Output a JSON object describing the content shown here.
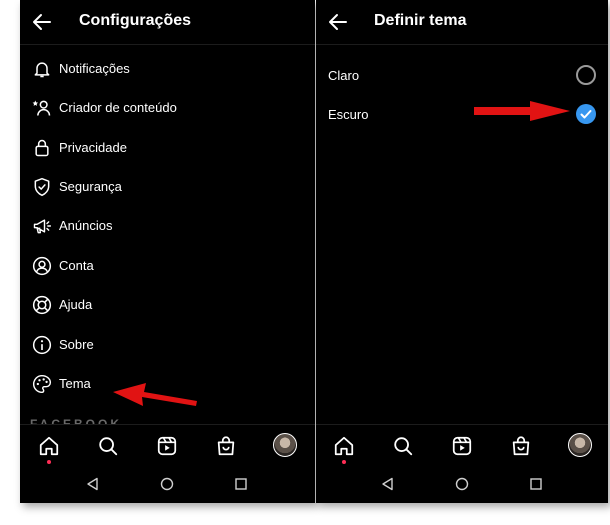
{
  "left": {
    "title": "Configurações",
    "menu": [
      {
        "label": "Notificações",
        "icon": "bell-icon"
      },
      {
        "label": "Criador de conteúdo",
        "icon": "creator-icon"
      },
      {
        "label": "Privacidade",
        "icon": "lock-icon"
      },
      {
        "label": "Segurança",
        "icon": "shield-icon"
      },
      {
        "label": "Anúncios",
        "icon": "megaphone-icon"
      },
      {
        "label": "Conta",
        "icon": "account-icon"
      },
      {
        "label": "Ajuda",
        "icon": "lifebuoy-icon"
      },
      {
        "label": "Sobre",
        "icon": "info-icon"
      },
      {
        "label": "Tema",
        "icon": "palette-icon"
      }
    ],
    "footer_text": "FACEBOOK"
  },
  "right": {
    "title": "Definir tema",
    "options": [
      {
        "label": "Claro",
        "selected": false
      },
      {
        "label": "Escuro",
        "selected": true
      }
    ]
  },
  "tabs": [
    "home-icon",
    "search-icon",
    "reels-icon",
    "shop-icon",
    "avatar"
  ],
  "system_nav": [
    "back-triangle-icon",
    "home-circle-icon",
    "recents-square-icon"
  ],
  "colors": {
    "background": "#000000",
    "text": "#ffffff",
    "accent": "#3797f0",
    "annotation_arrow": "#e11313",
    "notification_dot": "#ff2d55"
  }
}
